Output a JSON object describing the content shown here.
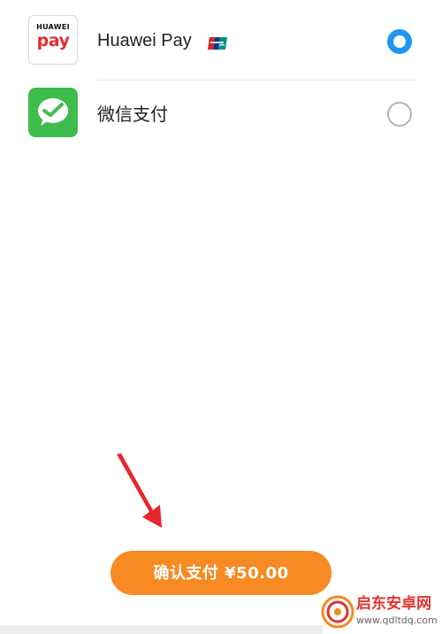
{
  "payment_options": [
    {
      "name": "Huawei Pay",
      "logo_line1": "HUAWEI",
      "logo_line2": "pay",
      "selected": true
    },
    {
      "name": "微信支付",
      "selected": false
    }
  ],
  "confirm_button": {
    "label": "确认支付 ¥50.00"
  },
  "watermark": {
    "name": "启东安卓网",
    "url": "www.qdltdq.com"
  },
  "colors": {
    "accent_orange": "#f78a22",
    "radio_blue": "#2096f3",
    "wechat_green": "#3ebd4d",
    "huawei_red": "#e22b30",
    "annotation_arrow": "#e8262e"
  },
  "icons": {
    "huawei_logo": "huawei-pay-logo",
    "wechat_logo": "wechat-pay-logo",
    "unionpay_badge": "unionpay-icon",
    "annotation": "red-arrow-icon"
  }
}
